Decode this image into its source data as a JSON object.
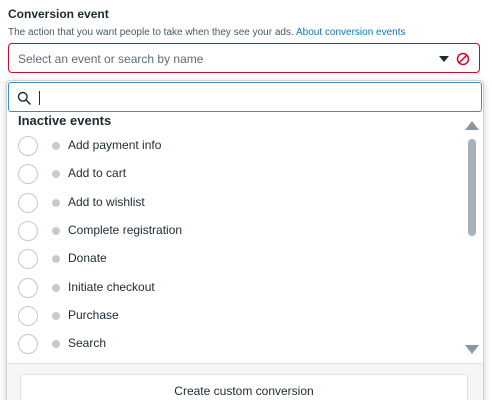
{
  "field": {
    "title": "Conversion event",
    "subtitle": "The action that you want people to take when they see your ads.",
    "help_link": "About conversion events",
    "placeholder": "Select an event or search by name",
    "caret_icon": "caret-down-icon",
    "error_icon": "prohibited-icon",
    "error_color": "#c80a28"
  },
  "dropdown": {
    "search_icon": "search-icon",
    "group_title": "Inactive events",
    "items": [
      {
        "label": "Add payment info"
      },
      {
        "label": "Add to cart"
      },
      {
        "label": "Add to wishlist"
      },
      {
        "label": "Complete registration"
      },
      {
        "label": "Donate"
      },
      {
        "label": "Initiate checkout"
      },
      {
        "label": "Purchase"
      },
      {
        "label": "Search"
      }
    ],
    "footer_button": "Create custom conversion",
    "status_dot_color": "#c6cbd0"
  }
}
